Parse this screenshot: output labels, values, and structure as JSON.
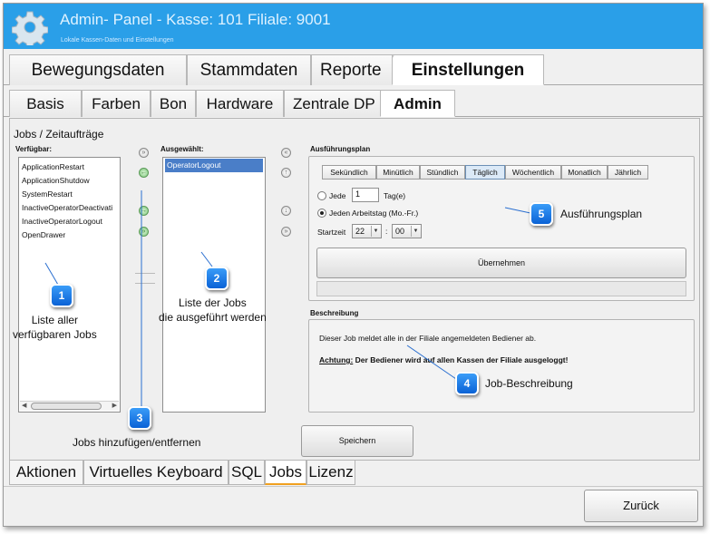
{
  "header": {
    "title": "Admin- Panel - Kasse: 101 Filiale: 9001",
    "subtitle": "Lokale Kassen-Daten und Einstellungen"
  },
  "main_tabs": [
    {
      "label": "Bewegungsdaten"
    },
    {
      "label": "Stammdaten"
    },
    {
      "label": "Reporte"
    },
    {
      "label": "Einstellungen"
    }
  ],
  "sub_tabs": [
    {
      "label": "Basis"
    },
    {
      "label": "Farben"
    },
    {
      "label": "Bon"
    },
    {
      "label": "Hardware"
    },
    {
      "label": "Zentrale DP"
    },
    {
      "label": "Admin"
    }
  ],
  "jobs": {
    "section_title": "Jobs / Zeitaufträge",
    "available_label": "Verfügbar:",
    "available": [
      "ApplicationRestart",
      "ApplicationShutdow",
      "SystemRestart",
      "InactiveOperatorDeactivati",
      "InactiveOperatorLogout",
      "OpenDrawer"
    ],
    "selected_label": "Ausgewählt:",
    "selected": [
      "OperatorLogout"
    ]
  },
  "plan": {
    "label": "Ausführungsplan",
    "tabs": [
      "Sekündlich",
      "Minütlich",
      "Stündlich",
      "Täglich",
      "Wöchentlich",
      "Monatlich",
      "Jährlich"
    ],
    "active_tab": "Täglich",
    "every_label": "Jede",
    "every_value": "1",
    "every_unit": "Tag(e)",
    "workday_label": "Jeden Arbeitstag (Mo.-Fr.)",
    "start_label": "Startzeit",
    "start_hour": "22",
    "time_sep": ":",
    "start_minute": "00",
    "apply_label": "Übernehmen"
  },
  "description": {
    "label": "Beschreibung",
    "text": "Dieser Job meldet alle in der Filiale angemeldeten Bediener ab.",
    "warning_prefix": "Achtung:",
    "warning_text": " Der Bediener wird auf allen Kassen der Filiale ausgeloggt!"
  },
  "save_label": "Speichern",
  "bottom_tabs": [
    {
      "label": "Aktionen"
    },
    {
      "label": "Virtuelles Keyboard"
    },
    {
      "label": "SQL"
    },
    {
      "label": "Jobs"
    },
    {
      "label": "Lizenz"
    }
  ],
  "back_label": "Zurück",
  "annotations": [
    {
      "num": "1",
      "text": "Liste aller\nverfügbaren Jobs"
    },
    {
      "num": "2",
      "text": "Liste der Jobs\ndie ausgeführt werden"
    },
    {
      "num": "3",
      "text": "Jobs hinzufügen/entfernen"
    },
    {
      "num": "4",
      "text": "Job-Beschreibung"
    },
    {
      "num": "5",
      "text": "Ausführungsplan"
    }
  ],
  "colors": {
    "header": "#2a9fe8",
    "accent": "#0a62d6",
    "selection": "#4a7ec8"
  }
}
